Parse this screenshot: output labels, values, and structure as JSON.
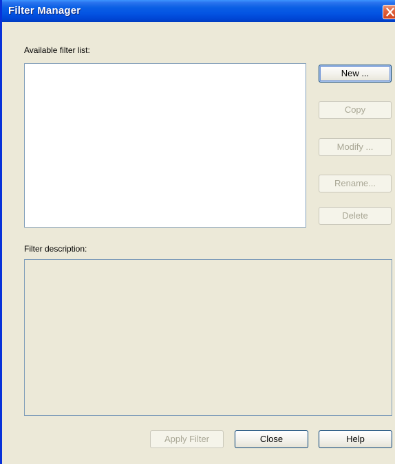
{
  "window": {
    "title": "Filter Manager"
  },
  "labels": {
    "available_filter_list": "Available filter list:",
    "filter_description": "Filter description:"
  },
  "buttons": {
    "new": "New ...",
    "copy": "Copy",
    "modify": "Modify ...",
    "rename": "Rename...",
    "delete": "Delete",
    "apply_filter": "Apply Filter",
    "close": "Close",
    "help": "Help"
  },
  "icons": {
    "title_close": "close-icon"
  },
  "colors": {
    "titlebar": "#0454e3",
    "dialog_bg": "#ece9d8",
    "close_button": "#e0623c",
    "field_border": "#7f9db9"
  }
}
